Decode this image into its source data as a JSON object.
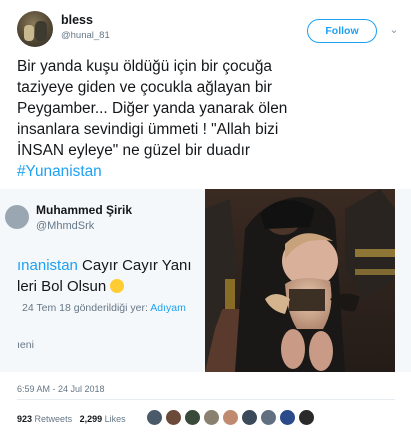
{
  "author": {
    "name": "bless",
    "handle": "@hunal_81"
  },
  "follow_label": "Follow",
  "tweet_lines": [
    "Bir yanda kuşu öldüğü için bir çocuğa",
    "taziyeye giden ve çocukla ağlayan bir",
    "Peygamber... Diğer yanda yanarak ölen",
    "insanlara sevindigi ümmeti ! \"Allah bizi",
    "İNSAN eyleye\" ne güzel bir duadır"
  ],
  "hashtag": "#Yunanistan",
  "quoted": {
    "name": "Muhammed Şirik",
    "handle": "@MhmdSrk",
    "text_blue": "ınanistan",
    "text_rest": " Cayır Cayır Yanı",
    "text_line2": "leri Bol Olsun",
    "meta_prefix": "24 Tem 18 gönderildiği yer: ",
    "meta_blue": "Adıyam",
    "translate": "ıeni"
  },
  "timestamp": "6:59 AM - 24 Jul 2018",
  "stats": {
    "retweets": "923",
    "retweets_label": "Retweets",
    "likes": "2,299",
    "likes_label": "Likes"
  },
  "liker_colors": [
    "#4a5a6a",
    "#6b4a3a",
    "#3a4a3a",
    "#8a8070",
    "#c08a70",
    "#3a4a5a",
    "#607080",
    "#2a4a8a",
    "#2a2a2a"
  ],
  "colors": {
    "accent": "#1da1f2",
    "text": "#14171a",
    "secondary": "#657786"
  }
}
